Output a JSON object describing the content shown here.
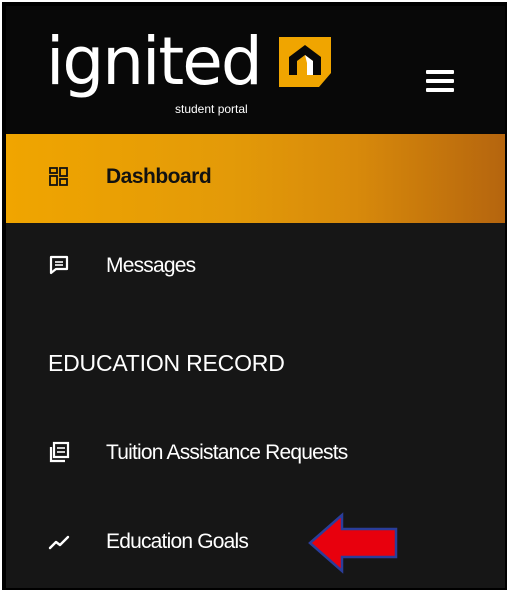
{
  "brand": {
    "logo_text": "ignited",
    "tagline": "student portal",
    "accent_color": "#f0a500",
    "logo_mark_icon": "ignited-logo-mark"
  },
  "header": {
    "menu_icon": "hamburger-menu-icon"
  },
  "nav": {
    "dashboard": {
      "label": "Dashboard",
      "icon": "dashboard-icon",
      "active": true
    },
    "messages": {
      "label": "Messages",
      "icon": "message-icon"
    },
    "section_heading": "EDUCATION RECORD",
    "tuition": {
      "label": "Tuition Assistance Requests",
      "icon": "documents-icon"
    },
    "goals": {
      "label": "Education Goals",
      "icon": "trending-up-icon"
    }
  },
  "annotation": {
    "arrow_color": "#e8000d",
    "arrow_icon": "left-arrow-annotation"
  }
}
